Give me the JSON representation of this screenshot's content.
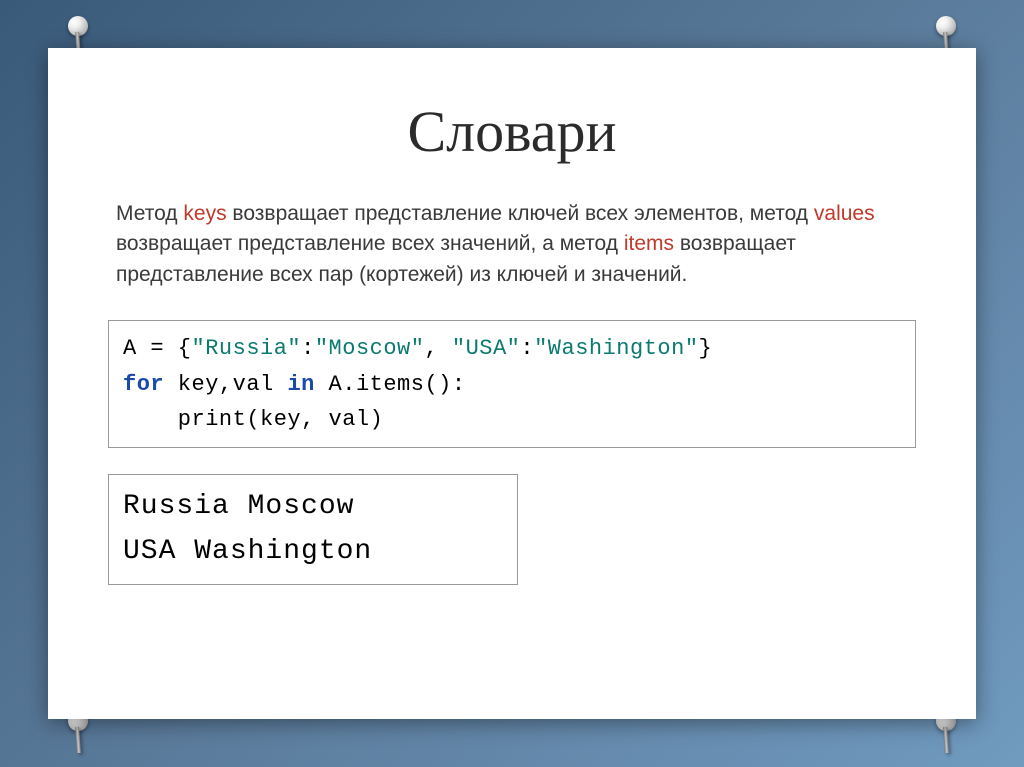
{
  "title": "Словари",
  "description": {
    "part1": "Метод ",
    "keys": "keys",
    "part2": " возвращает представление ключей всех элементов, метод ",
    "values": "values",
    "part3": " возвращает представление всех значений, а метод ",
    "items": "items",
    "part4": " возвращает представление всех пар (кортежей) из ключей и значений."
  },
  "code": {
    "line1_a": "A = {",
    "line1_s1": "\"Russia\"",
    "line1_c1": ":",
    "line1_s2": "\"Moscow\"",
    "line1_c2": ", ",
    "line1_s3": "\"USA\"",
    "line1_c3": ":",
    "line1_s4": "\"Washington\"",
    "line1_e": "}",
    "line2_kw": "for",
    "line2_mid": " key,val ",
    "line2_in": "in",
    "line2_end": " A.items():",
    "line3": "    print(key, val)"
  },
  "output": {
    "line1": "Russia Moscow",
    "line2": "USA Washington"
  }
}
